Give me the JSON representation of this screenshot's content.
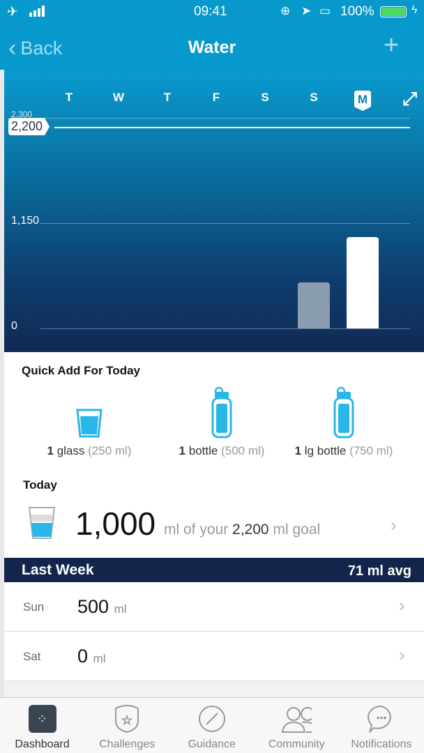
{
  "status_bar": {
    "time": "09:41",
    "battery": "100%",
    "icons": [
      "airplane-icon",
      "signal-icon",
      "rotation-lock-icon",
      "location-icon",
      "airplay-icon",
      "battery-icon",
      "charging-icon"
    ]
  },
  "nav": {
    "back": "Back",
    "title": "Water",
    "add_icon": "plus-icon"
  },
  "chart_data": {
    "type": "bar",
    "categories": [
      "T",
      "W",
      "T",
      "F",
      "S",
      "S",
      "M"
    ],
    "values": [
      0,
      0,
      0,
      0,
      0,
      500,
      1000
    ],
    "selected": "M",
    "yticks": [
      "0",
      "1,150",
      "2,300"
    ],
    "ylim": [
      0,
      2300
    ],
    "goal": 2200,
    "goal_label": "2,200",
    "colors": {
      "past": "#8a9db0",
      "today": "#ffffff"
    }
  },
  "quick_add": {
    "title": "Quick Add For Today",
    "items": [
      {
        "count": "1",
        "unit": "glass",
        "size": "(250 ml)",
        "icon": "glass-icon"
      },
      {
        "count": "1",
        "unit": "bottle",
        "size": "(500 ml)",
        "icon": "bottle-icon"
      },
      {
        "count": "1",
        "unit": "lg bottle",
        "size": "(750 ml)",
        "icon": "large-bottle-icon"
      }
    ]
  },
  "today": {
    "title": "Today",
    "amount": "1,000",
    "text1": "ml of your",
    "goal": "2,200",
    "text2": "ml goal"
  },
  "last_week": {
    "title": "Last Week",
    "avg": "71 ml avg",
    "rows": [
      {
        "day": "Sun",
        "value": "500",
        "unit": "ml"
      },
      {
        "day": "Sat",
        "value": "0",
        "unit": "ml"
      }
    ]
  },
  "tabs": [
    {
      "label": "Dashboard",
      "active": true
    },
    {
      "label": "Challenges"
    },
    {
      "label": "Guidance"
    },
    {
      "label": "Community"
    },
    {
      "label": "Notifications"
    }
  ],
  "accent": "#0899cc"
}
